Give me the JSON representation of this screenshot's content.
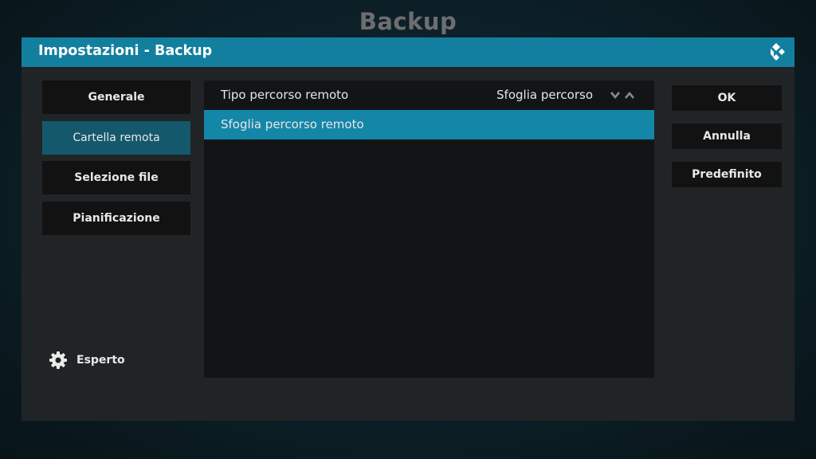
{
  "page": {
    "title": "Backup"
  },
  "dialog": {
    "title": "Impostazioni - Backup",
    "logo_icon": "kodi-logo-icon"
  },
  "categories": [
    {
      "label": "Generale",
      "active": false
    },
    {
      "label": "Cartella remota",
      "active": true
    },
    {
      "label": "Selezione file",
      "active": false
    },
    {
      "label": "Pianificazione",
      "active": false
    }
  ],
  "settings": [
    {
      "label": "Tipo percorso remoto",
      "value": "Sfoglia percorso",
      "control": "spinner",
      "focused": false
    },
    {
      "label": "Sfoglia percorso remoto",
      "value": "",
      "control": "button",
      "focused": true
    }
  ],
  "buttons": {
    "ok": "OK",
    "cancel": "Annulla",
    "default": "Predefinito"
  },
  "settings_level": {
    "icon": "gear-icon",
    "label": "Esperto"
  },
  "colors": {
    "accent": "#137f9f",
    "focus": "#1487a8",
    "active_category": "#14586c"
  }
}
